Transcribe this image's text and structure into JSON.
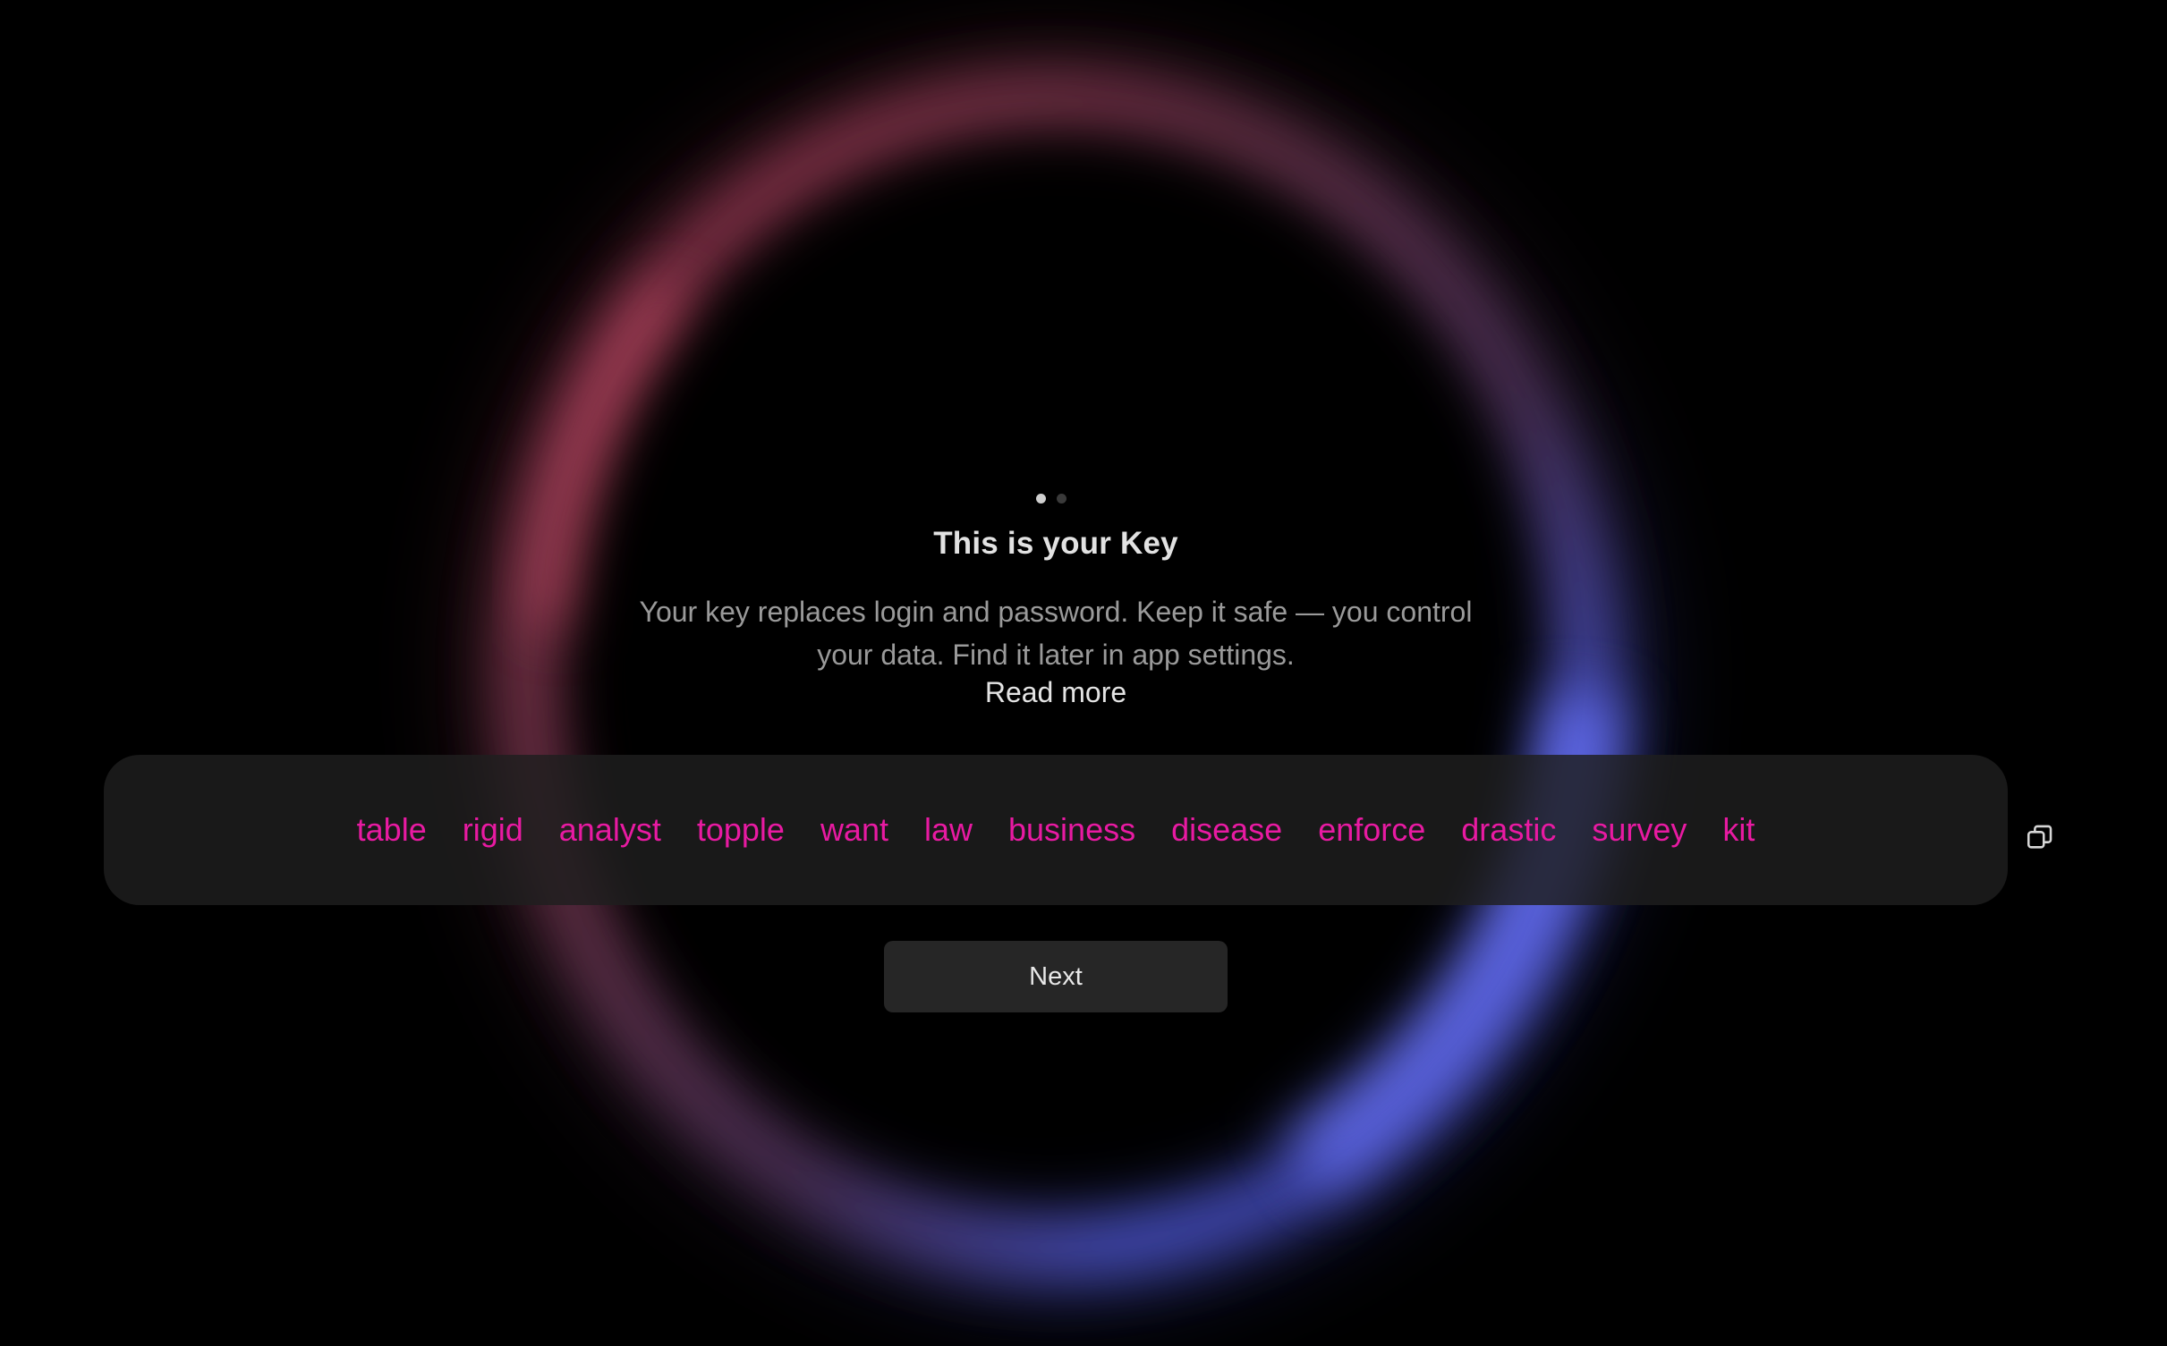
{
  "onboarding": {
    "step_indicator": {
      "current": 1,
      "total": 2
    },
    "title": "This is your Key",
    "description": "Your key replaces login and password. Keep it safe — you control your data. Find it later in app settings.",
    "read_more_label": "Read more",
    "phrase_words": [
      "table",
      "rigid",
      "analyst",
      "topple",
      "want",
      "law",
      "business",
      "disease",
      "enforce",
      "drastic",
      "survey",
      "kit"
    ],
    "copy_icon": "copy-icon",
    "next_label": "Next"
  },
  "colors": {
    "background": "#000000",
    "word_accent": "#e81aa2",
    "glow_pink": "#b4506e",
    "glow_blue": "#5a64e6"
  }
}
